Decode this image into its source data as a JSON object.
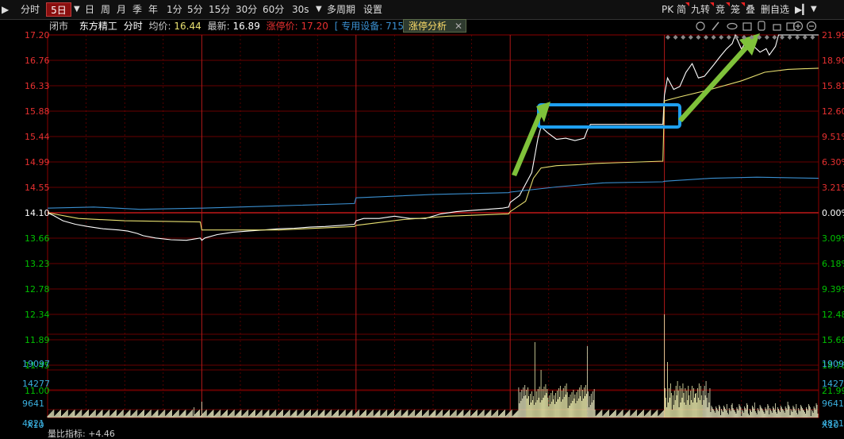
{
  "toolbar": {
    "items": [
      "分时",
      "5日",
      "日",
      "周",
      "月",
      "季",
      "年",
      "1分",
      "5分",
      "15分",
      "30分",
      "60分",
      "30s",
      "多周期",
      "设置"
    ],
    "active_index": 1,
    "right_items": [
      "PK",
      "简",
      "九转",
      "竞",
      "笼",
      "叠",
      "删自选"
    ]
  },
  "info": {
    "status": "闭市",
    "stock_name": "东方精工",
    "mode": "分时",
    "avg_label": "均价:",
    "avg_value": "16.44",
    "last_label": "最新:",
    "last_value": "16.89",
    "limit_label": "涨停价:",
    "limit_value": "17.20",
    "device_text": "[ 专用设备: 7151.962]",
    "analysis_label": "涨停分析",
    "analysis_close": "✕"
  },
  "bottom_text": {
    "label": "量比指标:",
    "value": "+4.46"
  },
  "colors": {
    "up": "#e83030",
    "down": "#00c000",
    "grid": "#8b0000",
    "price_line": "#ffffff",
    "avg_line": "#e8e070",
    "index_line": "#3a8fd0",
    "highlight_box": "#1ea0f0",
    "arrow": "#7fc23a",
    "volume": "#e8e8c0"
  },
  "chart_data": {
    "type": "line",
    "days": 5,
    "y_price_ticks": [
      "17.20",
      "16.76",
      "16.33",
      "15.88",
      "15.44",
      "14.99",
      "14.55",
      "14.10",
      "13.66",
      "13.23",
      "12.78",
      "12.34",
      "11.89",
      "11.45",
      "11.00"
    ],
    "y_pct_ticks": [
      "21.99%",
      "18.90%",
      "15.81%",
      "12.60%",
      "9.51%",
      "6.30%",
      "3.21%",
      "0.00%",
      "3.09%",
      "6.18%",
      "9.39%",
      "12.48%",
      "15.69%",
      "18.78%",
      "21.99%"
    ],
    "prev_close": 14.1,
    "ylim": [
      11.0,
      17.2
    ],
    "volume_ticks": [
      "19097",
      "14277",
      "9641",
      "4821"
    ],
    "volume_unit": "X10",
    "series": [
      {
        "name": "price",
        "points": [
          [
            0,
            14.1
          ],
          [
            0.04,
            14.05
          ],
          [
            0.1,
            13.96
          ],
          [
            0.18,
            13.9
          ],
          [
            0.26,
            13.86
          ],
          [
            0.36,
            13.82
          ],
          [
            0.46,
            13.8
          ],
          [
            0.52,
            13.78
          ],
          [
            0.58,
            13.74
          ],
          [
            0.62,
            13.7
          ],
          [
            0.7,
            13.66
          ],
          [
            0.8,
            13.63
          ],
          [
            0.9,
            13.62
          ],
          [
            0.99,
            13.66
          ],
          [
            1.0,
            13.62
          ],
          [
            1.02,
            13.66
          ],
          [
            1.1,
            13.72
          ],
          [
            1.2,
            13.76
          ],
          [
            1.3,
            13.78
          ],
          [
            1.4,
            13.8
          ],
          [
            1.5,
            13.82
          ],
          [
            1.6,
            13.83
          ],
          [
            1.7,
            13.85
          ],
          [
            1.8,
            13.86
          ],
          [
            1.9,
            13.88
          ],
          [
            1.99,
            13.9
          ],
          [
            2.0,
            13.96
          ],
          [
            2.05,
            14.0
          ],
          [
            2.15,
            14.0
          ],
          [
            2.25,
            14.04
          ],
          [
            2.35,
            14.0
          ],
          [
            2.45,
            14.0
          ],
          [
            2.55,
            14.08
          ],
          [
            2.65,
            14.12
          ],
          [
            2.75,
            14.14
          ],
          [
            2.85,
            14.16
          ],
          [
            2.95,
            14.18
          ],
          [
            2.99,
            14.2
          ],
          [
            3.0,
            14.28
          ],
          [
            3.06,
            14.4
          ],
          [
            3.1,
            14.6
          ],
          [
            3.14,
            14.8
          ],
          [
            3.16,
            15.1
          ],
          [
            3.18,
            15.4
          ],
          [
            3.2,
            15.6
          ],
          [
            3.24,
            15.5
          ],
          [
            3.3,
            15.38
          ],
          [
            3.36,
            15.4
          ],
          [
            3.42,
            15.36
          ],
          [
            3.48,
            15.4
          ],
          [
            3.5,
            15.54
          ],
          [
            3.52,
            15.64
          ],
          [
            3.55,
            15.64
          ],
          [
            3.99,
            15.64
          ],
          [
            4.0,
            16.15
          ],
          [
            4.02,
            16.45
          ],
          [
            4.04,
            16.35
          ],
          [
            4.06,
            16.25
          ],
          [
            4.1,
            16.3
          ],
          [
            4.14,
            16.55
          ],
          [
            4.18,
            16.7
          ],
          [
            4.22,
            16.45
          ],
          [
            4.26,
            16.48
          ],
          [
            4.32,
            16.68
          ],
          [
            4.36,
            16.82
          ],
          [
            4.4,
            16.95
          ],
          [
            4.44,
            17.05
          ],
          [
            4.46,
            17.2
          ],
          [
            4.5,
            16.95
          ],
          [
            4.54,
            17.15
          ],
          [
            4.58,
            17.0
          ],
          [
            4.62,
            16.9
          ],
          [
            4.66,
            16.96
          ],
          [
            4.68,
            16.85
          ],
          [
            4.72,
            17.0
          ],
          [
            4.74,
            17.2
          ],
          [
            4.78,
            17.2
          ],
          [
            5.0,
            17.2
          ]
        ]
      },
      {
        "name": "avg",
        "points": [
          [
            0,
            14.1
          ],
          [
            0.2,
            14.0
          ],
          [
            0.5,
            13.96
          ],
          [
            0.99,
            13.94
          ],
          [
            1.0,
            13.8
          ],
          [
            1.5,
            13.8
          ],
          [
            1.99,
            13.86
          ],
          [
            2.0,
            13.88
          ],
          [
            2.3,
            13.98
          ],
          [
            2.6,
            14.04
          ],
          [
            2.99,
            14.08
          ],
          [
            3.0,
            14.12
          ],
          [
            3.1,
            14.3
          ],
          [
            3.15,
            14.7
          ],
          [
            3.2,
            14.88
          ],
          [
            3.3,
            14.92
          ],
          [
            3.45,
            14.94
          ],
          [
            3.55,
            14.96
          ],
          [
            3.99,
            15.0
          ],
          [
            4.0,
            16.05
          ],
          [
            4.1,
            16.12
          ],
          [
            4.3,
            16.25
          ],
          [
            4.5,
            16.4
          ],
          [
            4.65,
            16.55
          ],
          [
            4.8,
            16.6
          ],
          [
            5.0,
            16.62
          ]
        ]
      },
      {
        "name": "index",
        "points": [
          [
            0,
            14.18
          ],
          [
            0.3,
            14.2
          ],
          [
            0.6,
            14.16
          ],
          [
            0.99,
            14.18
          ],
          [
            1.0,
            14.18
          ],
          [
            1.5,
            14.22
          ],
          [
            1.99,
            14.26
          ],
          [
            2.0,
            14.36
          ],
          [
            2.5,
            14.42
          ],
          [
            2.99,
            14.45
          ],
          [
            3.0,
            14.46
          ],
          [
            3.3,
            14.55
          ],
          [
            3.6,
            14.62
          ],
          [
            3.99,
            14.64
          ],
          [
            4.0,
            14.65
          ],
          [
            4.3,
            14.7
          ],
          [
            4.6,
            14.72
          ],
          [
            5.0,
            14.7
          ]
        ]
      }
    ]
  }
}
